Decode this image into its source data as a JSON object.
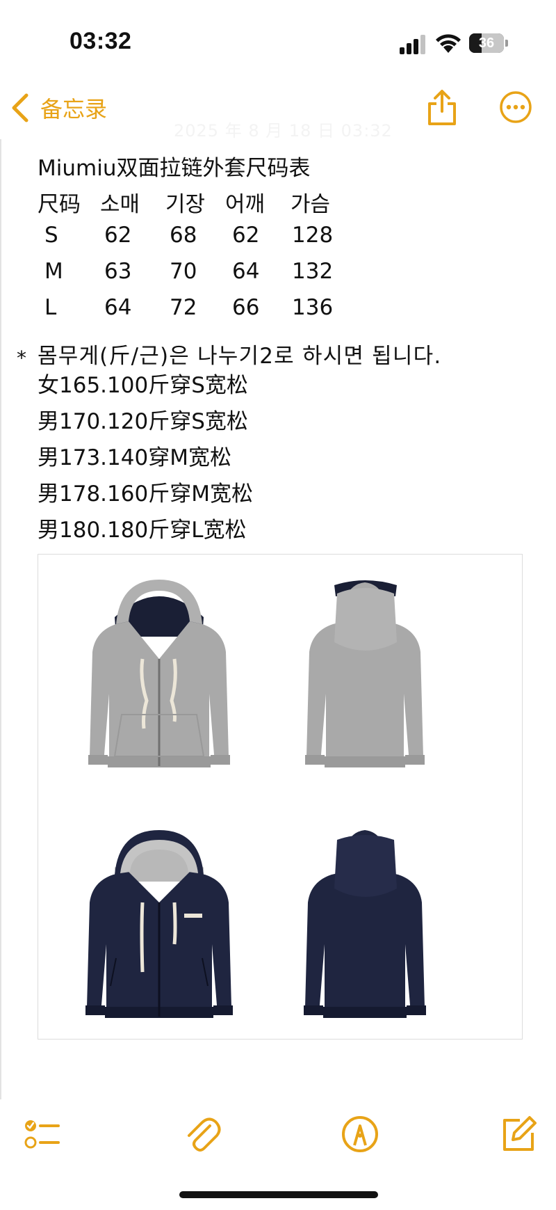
{
  "status_bar": {
    "time": "03:32",
    "battery_level": "36"
  },
  "nav": {
    "back_label": "备忘录",
    "timestamp": "2025 年 8 月 18 日 03:32"
  },
  "note": {
    "title": "Miumiu双面拉链外套尺码表",
    "size_table": {
      "headers": [
        "尺码",
        "소매",
        "기장",
        "어깨",
        "가슴"
      ],
      "rows": [
        [
          "S",
          "62",
          "68",
          "62",
          "128"
        ],
        [
          "M",
          "63",
          "70",
          "64",
          "132"
        ],
        [
          "L",
          "64",
          "72",
          "66",
          "136"
        ]
      ]
    },
    "bullet": "*",
    "weight_note": "몸무게(斤/근)은 나누기2로 하시면 됩니다.",
    "fit_lines": [
      "女165.100斤穿S宽松",
      "男170.120斤穿S宽松",
      "男173.140穿M宽松",
      "男178.160斤穿M宽松",
      "男180.180斤穿L宽松"
    ]
  },
  "image": {
    "views": [
      "grey-front",
      "grey-back",
      "navy-front",
      "navy-back"
    ],
    "colors": {
      "grey": "#a9a9a9",
      "grey_dark": "#8f8f8f",
      "navy": "#1f2540",
      "navy_dark": "#151a30",
      "hood_lining_navy": "#1a1f35",
      "hood_lining_grey": "#b8b8b8",
      "drawcord": "#ece6d8"
    }
  },
  "toolbar": {
    "icons": [
      "checklist-icon",
      "paperclip-icon",
      "markup-pen-icon",
      "compose-icon"
    ]
  },
  "theme": {
    "accent": "#e8a317"
  }
}
